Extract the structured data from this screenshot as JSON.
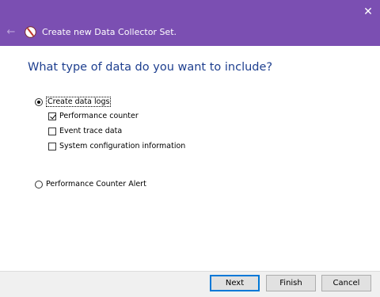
{
  "window": {
    "title": "Create new Data Collector Set.",
    "close_glyph": "✕",
    "back_glyph": "←"
  },
  "page": {
    "heading": "What type of data do you want to include?"
  },
  "options": {
    "create_logs": {
      "label": "Create data logs",
      "selected": true
    },
    "performance_counter": {
      "label": "Performance counter",
      "checked": true
    },
    "event_trace": {
      "label": "Event trace data",
      "checked": false
    },
    "system_config": {
      "label": "System configuration information",
      "checked": false
    },
    "counter_alert": {
      "label": "Performance Counter Alert",
      "selected": false
    }
  },
  "buttons": {
    "next": "Next",
    "finish": "Finish",
    "cancel": "Cancel"
  },
  "colors": {
    "titlebar": "#7b4fb2",
    "heading": "#1e3f8f",
    "accent": "#0078d7"
  }
}
